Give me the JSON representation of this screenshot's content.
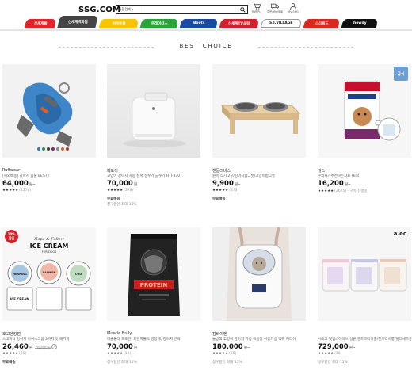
{
  "header": {
    "logo": "SSG.COM",
    "search_category": "통합검색",
    "search_value": "",
    "icons": [
      {
        "name": "cart-icon",
        "label": "장바구니"
      },
      {
        "name": "delivery-icon",
        "label": "주문/배송조회"
      },
      {
        "name": "user-icon",
        "label": "My SSG"
      }
    ]
  },
  "tabs": [
    {
      "label": "신세계몰",
      "color": "#e3252b"
    },
    {
      "label": "신세계백화점",
      "color": "#444444",
      "active": true
    },
    {
      "label": "이마트몰",
      "color": "#f7c500"
    },
    {
      "label": "트레이더스",
      "color": "#28a43a"
    },
    {
      "label": "Boots",
      "color": "#1a4ba0"
    },
    {
      "label": "신세계TV쇼핑",
      "color": "#d0202e"
    },
    {
      "label": "S.I.VILLAGE",
      "color": "#ffffff",
      "text_color": "#222222"
    },
    {
      "label": "스타필드",
      "color": "#d9281f"
    },
    {
      "label": "howdy",
      "color": "#111111"
    }
  ],
  "section": {
    "title": "BEST CHOICE"
  },
  "products": [
    {
      "brand": "Ruffwear",
      "name": "[해외배송] 강아지 몸줄 BEST !",
      "price": "64,000",
      "won": "원~",
      "orig": "",
      "stars": "★★★★★",
      "reviews": "(1578)",
      "ship": "",
      "ship2": ""
    },
    {
      "brand": "페토이",
      "name": "고양이 강아지 자동 센서 정수기 급수기 HTF330",
      "price": "70,000",
      "won": "원",
      "orig": "",
      "stars": "★★★★★",
      "reviews": "(378)",
      "ship": "무료배송",
      "ship2": "청구할인 최대 15%"
    },
    {
      "brand": "챈들러비스",
      "name": "원목 식기 2구/강아지밥그릇/고양이밥그릇",
      "price": "9,900",
      "won": "원~",
      "orig": "",
      "stars": "★★★★★",
      "reviews": "(473)",
      "ship": "무료배송",
      "ship2": ""
    },
    {
      "brand": "힐스",
      "name": "수의사가추천하는사료 Hills",
      "price": "16,200",
      "won": "원~",
      "orig": "",
      "stars": "★★★★★",
      "reviews": "(2075) · 구독 진행중",
      "ship": "",
      "ship2": "",
      "tag": "공식"
    },
    {
      "brand": "호고엔킹덤",
      "name": "스테파니 강아지 아이스크림 3가지 맛 패키지",
      "price": "26,460",
      "won": "원",
      "orig": "29,400원",
      "stars": "★★★★★",
      "reviews": "(60)",
      "ship": "무료배송",
      "ship2": "",
      "badge": "10%",
      "badge2": "할인"
    },
    {
      "brand": "Muscle Bully",
      "name": "머슬불리 프로틴, 프렌치불독 영양제, 강아지 근육",
      "price": "70,000",
      "won": "원",
      "orig": "",
      "stars": "★★★★★",
      "reviews": "(14)",
      "ship": "",
      "ship2": "청구할인 최대 15%"
    },
    {
      "brand": "캄바이엔",
      "name": "놀방책 고양이 강아지 가방 이동장 이동가방 백팩 캐리어",
      "price": "180,000",
      "won": "원~",
      "orig": "",
      "stars": "★★★★★",
      "reviews": "(55)",
      "ship": "",
      "ship2": "청구할인 최대 15%"
    },
    {
      "brand": "",
      "name": "아베크 펫템스하이브 살균 핸드드라이룸/펫드라이룸/털터세트중형",
      "price": "729,000",
      "won": "원~",
      "orig": "",
      "stars": "★★★★★",
      "reviews": "(18)",
      "ship": "",
      "ship2": "청구할인 최대 15%",
      "logo": "a.ec"
    }
  ],
  "product_images": {
    "harness_colors": [
      "#3a78b8",
      "#2f8f4e",
      "#3a3a3a",
      "#7a2a6a",
      "#8a8a8a",
      "#d06020",
      "#c43030"
    ],
    "icecream_flavors": [
      "HERRING",
      "SALMON",
      "COD"
    ],
    "icecream_box_text": "ICE CREAM",
    "icecream_box_sub": "FOR DOGS",
    "icecream_script": "Hope & Fellow",
    "protein_text": "PROTEIN"
  }
}
